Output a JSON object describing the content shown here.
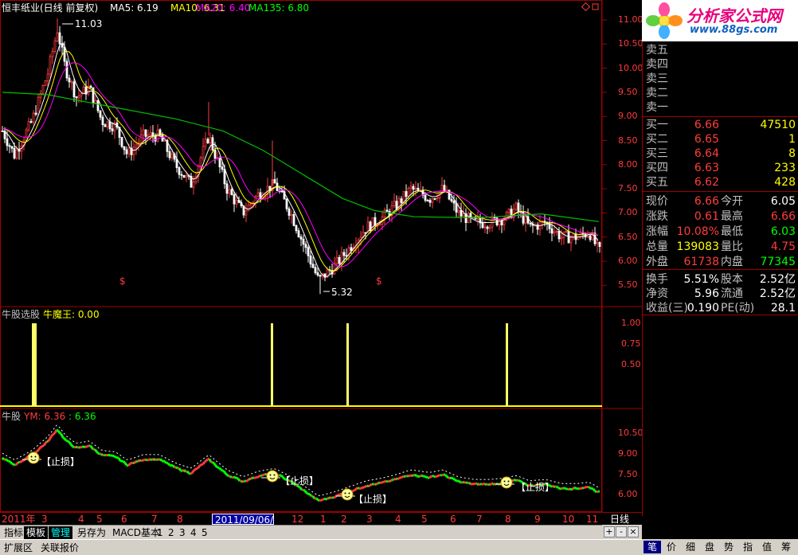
{
  "main_chart": {
    "title": "恒丰纸业(日线 前复权)",
    "ma5_label": "MA5: 6.19",
    "ma10_label": "MA10: 6.31",
    "ma20_label": "MA20: 6.40",
    "ma135_label": "MA135: 6.80",
    "high_mark": "11.03",
    "low_mark": "5.32",
    "signal_mark": "$",
    "price_ticks": [
      "11.00",
      "10.50",
      "10.00",
      "9.50",
      "9.00",
      "8.50",
      "8.00",
      "7.50",
      "7.00",
      "6.50",
      "6.00",
      "5.50"
    ]
  },
  "indicator1": {
    "title": "牛股选股",
    "value_label": "牛魔王: 0.00",
    "ticks": [
      "1.00",
      "0.75",
      "0.50"
    ]
  },
  "indicator2": {
    "title": "牛股",
    "ym_label": "YM: 6.36",
    "val_label": ": 6.36",
    "stop_label": "【止损】",
    "ticks": [
      "10.50",
      "9.00",
      "7.50",
      "6.00"
    ]
  },
  "date_axis": {
    "labels": [
      "2011年",
      "3",
      "4",
      "5",
      "6",
      "7",
      "8",
      "12",
      "1",
      "2",
      "3",
      "4",
      "5",
      "6",
      "7",
      "8",
      "9",
      "10",
      "11"
    ],
    "highlight": "2011/09/06/二",
    "period": "日线"
  },
  "tabs": [
    "指标",
    "模板",
    "管理",
    "另存为",
    "MACD基本",
    "1",
    "2",
    "3",
    "4",
    "5"
  ],
  "status_buttons": [
    "扩展区",
    "关联报价"
  ],
  "right_bottom_buttons": [
    "笔",
    "价",
    "细",
    "盘",
    "势",
    "指",
    "值",
    "筹"
  ],
  "logo": {
    "line1": "分析家公式网",
    "line2": "www.88gs.com"
  },
  "order_book": {
    "sell": [
      {
        "label": "卖五",
        "price": "",
        "vol": ""
      },
      {
        "label": "卖四",
        "price": "",
        "vol": ""
      },
      {
        "label": "卖三",
        "price": "",
        "vol": ""
      },
      {
        "label": "卖二",
        "price": "",
        "vol": ""
      },
      {
        "label": "卖一",
        "price": "",
        "vol": ""
      }
    ],
    "buy": [
      {
        "label": "买一",
        "price": "6.66",
        "vol": "47510"
      },
      {
        "label": "买二",
        "price": "6.65",
        "vol": "1"
      },
      {
        "label": "买三",
        "price": "6.64",
        "vol": "8"
      },
      {
        "label": "买四",
        "price": "6.63",
        "vol": "233"
      },
      {
        "label": "买五",
        "price": "6.62",
        "vol": "428"
      }
    ]
  },
  "quote": [
    {
      "k1": "现价",
      "v1": "6.66",
      "c1": "#ff3c3c",
      "k2": "今开",
      "v2": "6.05",
      "c2": "#ffffff"
    },
    {
      "k1": "涨跌",
      "v1": "0.61",
      "c1": "#ff3c3c",
      "k2": "最高",
      "v2": "6.66",
      "c2": "#ff3c3c"
    },
    {
      "k1": "涨幅",
      "v1": "10.08%",
      "c1": "#ff3c3c",
      "k2": "最低",
      "v2": "6.03",
      "c2": "#00ff00"
    },
    {
      "k1": "总量",
      "v1": "139083",
      "c1": "#ffff00",
      "k2": "量比",
      "v2": "4.75",
      "c2": "#ff3c3c"
    },
    {
      "k1": "外盘",
      "v1": "61738",
      "c1": "#ff3c3c",
      "k2": "内盘",
      "v2": "77345",
      "c2": "#00ff00"
    }
  ],
  "fundamentals": [
    {
      "k1": "换手",
      "v1": "5.51%",
      "k2": "股本",
      "v2": "2.52亿"
    },
    {
      "k1": "净资",
      "v1": "5.96",
      "k2": "流通",
      "v2": "2.52亿"
    },
    {
      "k1": "收益(三)",
      "v1": "0.190",
      "k2": "PE(动)",
      "v2": "28.1"
    }
  ]
}
